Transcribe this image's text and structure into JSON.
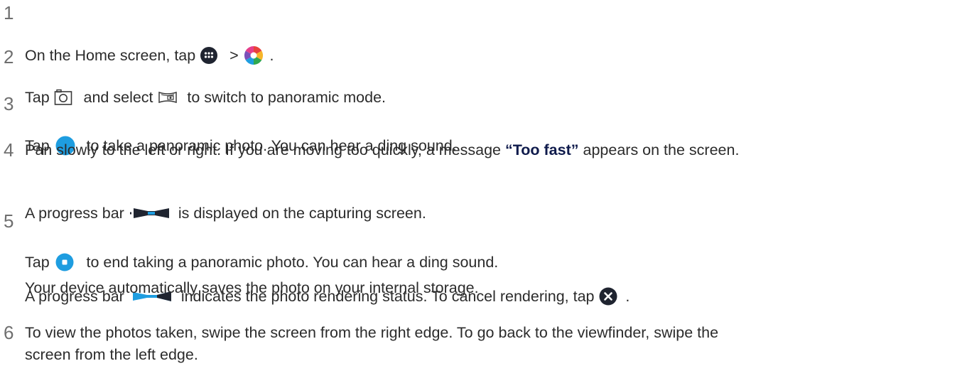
{
  "steps": [
    {
      "number": "1",
      "lines": [
        {
          "t1": "On the Home screen, tap",
          "t2": ">",
          "t3": "."
        }
      ],
      "icons": [
        "apps-grid-icon",
        "camera-shutter-icon"
      ]
    },
    {
      "number": "2",
      "lines": [
        {
          "t1": "Tap",
          "t2": "and select",
          "t3": "to switch to panoramic mode."
        }
      ],
      "icons": [
        "camera-mode-icon",
        "panorama-mode-icon"
      ]
    },
    {
      "number": "3",
      "lines": [
        {
          "t1": "Tap",
          "t2": "to take a panoramic photo. You can hear a ding sound."
        }
      ],
      "icons": [
        "shutter-button-icon"
      ]
    },
    {
      "number": "4",
      "lines": [
        {
          "t1": "Pan slowly to the left or right. If you are moving too quickly, a message",
          "bold": "“Too fast”",
          "t2": "appears on the screen."
        },
        {
          "t1": "A progress bar",
          "t2": "is displayed on the capturing screen."
        }
      ],
      "icons": [
        "capture-progress-bar-icon"
      ]
    },
    {
      "number": "5",
      "lines": [
        {
          "t1": "Tap",
          "t2": "to end taking a panoramic photo. You can hear a ding sound."
        },
        {
          "t1": "A progress bar",
          "t2": "indicates the photo rendering status. To cancel rendering, tap",
          "t3": "."
        },
        {
          "t1": "Your device automatically saves the photo on your internal storage."
        }
      ],
      "icons": [
        "stop-button-icon",
        "rendering-progress-bar-icon",
        "cancel-icon"
      ]
    },
    {
      "number": "6",
      "lines": [
        {
          "t1": "To view the photos taken, swipe the screen from the right edge. To go back to the viewfinder, swipe the"
        },
        {
          "t1": "screen from the left edge."
        }
      ]
    }
  ],
  "colors": {
    "number": "#6f6f6f",
    "text": "#2b2b2b",
    "bold_text": "#0f1b4c",
    "accent_blue": "#1e9de0",
    "icon_dark": "#1f2430"
  }
}
